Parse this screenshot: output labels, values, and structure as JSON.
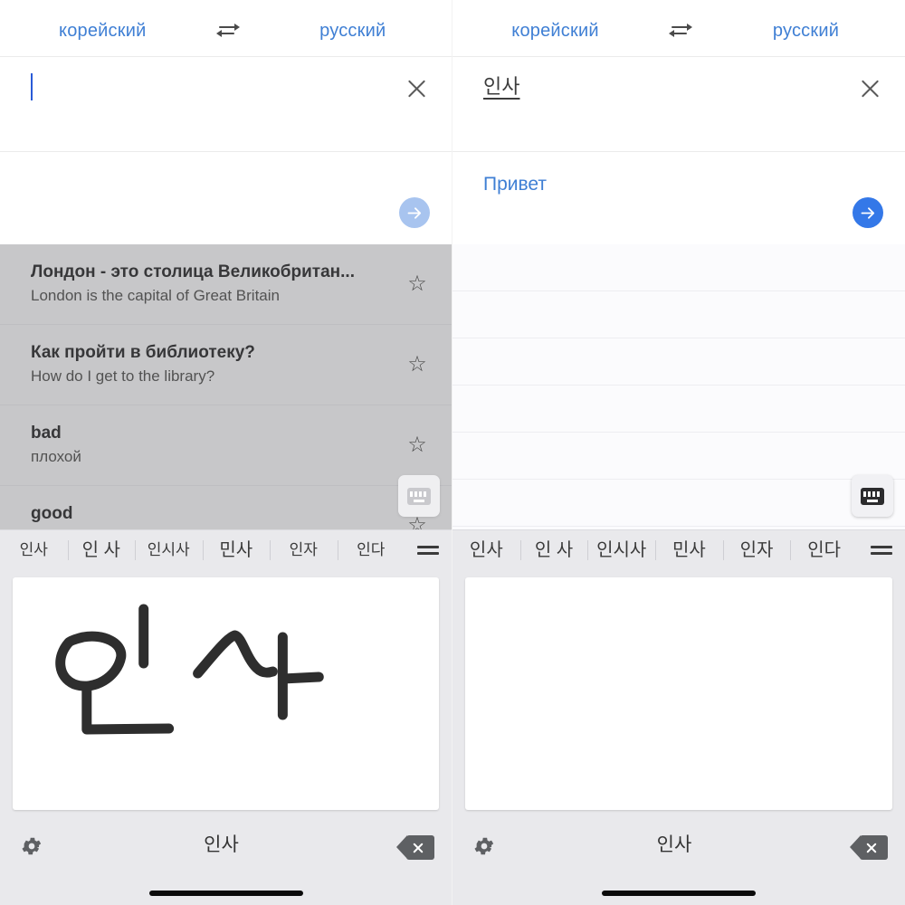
{
  "app": {
    "name": "translator-with-korean-handwriting-keyboard",
    "accent_blue": "#3f7fd4",
    "go_enabled_color": "#3478e8",
    "go_disabled_color": "#a8c4ef",
    "keyboard_bg": "#e9e9ec"
  },
  "panels": [
    {
      "id": "left",
      "language_bar": {
        "source_label": "корейский",
        "target_label": "русский",
        "swap_icon": "swap-horizontal-icon"
      },
      "input": {
        "value": "",
        "composing": false,
        "caret_visible": true,
        "clear_icon": "close-icon"
      },
      "result": {
        "text": "",
        "go_icon": "arrow-right-circle-icon",
        "go_enabled": false
      },
      "history": {
        "dimmed": true,
        "blank": false,
        "items": [
          {
            "source": "Лондон - это столица Великобритан...",
            "target": "London is the capital of Great Britain",
            "star_icon": "star-outline-icon"
          },
          {
            "source": "Как пройти в библиотеку?",
            "target": "How do I get to the library?",
            "star_icon": "star-outline-icon"
          },
          {
            "source": "bad",
            "target": "плохой",
            "star_icon": "star-outline-icon"
          },
          {
            "source": "good",
            "target": "",
            "star_icon": "star-outline-icon"
          }
        ]
      },
      "keyboard_toggle": {
        "icon": "keyboard-icon",
        "faded": true
      },
      "keyboard": {
        "candidates": [
          {
            "text": "인사",
            "emphasized": false
          },
          {
            "text": "인 사",
            "emphasized": true
          },
          {
            "text": "인시사",
            "emphasized": false
          },
          {
            "text": "민사",
            "emphasized": true
          },
          {
            "text": "인자",
            "emphasized": false
          },
          {
            "text": "인다",
            "emphasized": false
          }
        ],
        "more_icon": "more-candidates-icon",
        "handwriting_visible": true,
        "settings_icon": "gear-icon",
        "committed_word": "인사",
        "backspace_icon": "backspace-icon"
      }
    },
    {
      "id": "right",
      "language_bar": {
        "source_label": "корейский",
        "target_label": "русский",
        "swap_icon": "swap-horizontal-icon"
      },
      "input": {
        "value": "인사",
        "composing": true,
        "caret_visible": false,
        "clear_icon": "close-icon"
      },
      "result": {
        "text": "Привет",
        "go_icon": "arrow-right-circle-icon",
        "go_enabled": true
      },
      "history": {
        "dimmed": false,
        "blank": true,
        "items": [
          {
            "source": "",
            "target": "",
            "star_icon": ""
          },
          {
            "source": "",
            "target": "",
            "star_icon": ""
          },
          {
            "source": "",
            "target": "",
            "star_icon": ""
          },
          {
            "source": "",
            "target": "",
            "star_icon": ""
          },
          {
            "source": "",
            "target": "",
            "star_icon": ""
          },
          {
            "source": "",
            "target": "",
            "star_icon": ""
          }
        ]
      },
      "keyboard_toggle": {
        "icon": "keyboard-icon",
        "faded": false
      },
      "keyboard": {
        "candidates": [
          {
            "text": "인사",
            "emphasized": false
          },
          {
            "text": "인 사",
            "emphasized": false
          },
          {
            "text": "인시사",
            "emphasized": false
          },
          {
            "text": "민사",
            "emphasized": false
          },
          {
            "text": "인자",
            "emphasized": false
          },
          {
            "text": "인다",
            "emphasized": false
          }
        ],
        "more_icon": "more-candidates-icon",
        "handwriting_visible": false,
        "settings_icon": "gear-icon",
        "committed_word": "인사",
        "backspace_icon": "backspace-icon"
      }
    }
  ]
}
